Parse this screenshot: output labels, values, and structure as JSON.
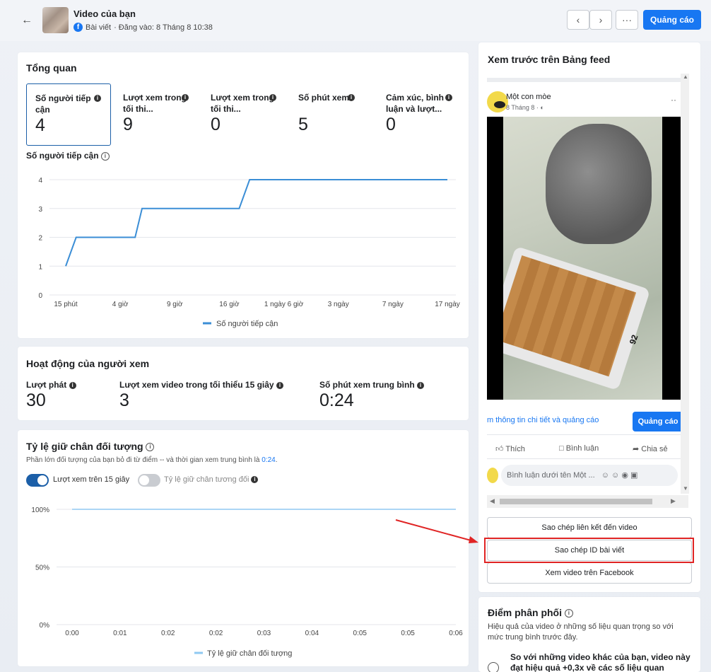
{
  "header": {
    "title": "Video của bạn",
    "subtitle_type": "Bài viết",
    "subtitle_date": "· Đăng vào: 8 Tháng 8 10:38",
    "prev_icon": "chevron-left-icon",
    "next_icon": "chevron-right-icon",
    "more_label": "···",
    "ads_label": "Quảng cáo"
  },
  "overview": {
    "title": "Tổng quan",
    "metrics": [
      {
        "label": "Số người tiếp cận",
        "value": "4"
      },
      {
        "label": "Lượt xem trong tối thi...",
        "value": "9"
      },
      {
        "label": "Lượt xem trong tối thi...",
        "value": "0"
      },
      {
        "label": "Số phút xem",
        "value": "5"
      },
      {
        "label": "Cảm xúc, bình luận và lượt...",
        "value": "0"
      }
    ],
    "chart_label": "Số người tiếp cận"
  },
  "chart_data": [
    {
      "type": "line",
      "title": "Số người tiếp cận",
      "x": [
        "15 phút",
        "4 giờ",
        "9 giờ",
        "16 giờ",
        "1 ngày 6 giờ",
        "3 ngày",
        "7 ngày",
        "17 ngày"
      ],
      "yticks": [
        0,
        1,
        2,
        3,
        4
      ],
      "ylim": [
        0,
        4
      ],
      "series": [
        {
          "name": "Số người tiếp cận",
          "color": "#3b8ed6",
          "points": [
            [
              0,
              1
            ],
            [
              0.06,
              2
            ],
            [
              0.4,
              2
            ],
            [
              0.44,
              3
            ],
            [
              1.0,
              3
            ],
            [
              1.06,
              4
            ],
            [
              1.5,
              4
            ],
            [
              2.2,
              4
            ]
          ]
        }
      ],
      "legend": "bottom-center"
    },
    {
      "type": "line",
      "title": "Tỷ lệ giữ chân đối tượng",
      "x": [
        "0:00",
        "0:01",
        "0:02",
        "0:02",
        "0:03",
        "0:04",
        "0:05",
        "0:05",
        "0:06"
      ],
      "yticks": [
        "0%",
        "50%",
        "100%"
      ],
      "ylim": [
        0,
        100
      ],
      "series": [
        {
          "name": "Tỷ lệ giữ chân đối tượng",
          "color": "#8fc9f2",
          "values": [
            100,
            100,
            100,
            100,
            100,
            100,
            100,
            100,
            100
          ]
        }
      ],
      "legend": "bottom-center"
    }
  ],
  "viewer_activity": {
    "title": "Hoạt động của người xem",
    "stats": [
      {
        "label": "Lượt phát",
        "value": "30"
      },
      {
        "label": "Lượt xem video trong tối thiểu 15 giây",
        "value": "3"
      },
      {
        "label": "Số phút xem trung bình",
        "value": "0:24"
      }
    ]
  },
  "retention": {
    "title": "Tỷ lệ giữ chân đối tượng",
    "desc_prefix": "Phần lớn đối tượng của bạn bỏ đi từ điểm -- và thời gian xem trung bình là ",
    "desc_time": "0:24",
    "desc_suffix": ".",
    "toggle1": "Lượt xem trên 15 giây",
    "toggle2": "Tỷ lệ giữ chân tương đối"
  },
  "preview": {
    "title": "Xem trước trên Bảng feed",
    "page_name": "Một con mòe",
    "post_date": "8 Tháng 8 ·",
    "more": "··",
    "info_link": "m thông tin chi tiết và quảng cáo",
    "ads_button": "Quảng cáo",
    "like": "Thích",
    "comment": "Bình luận",
    "share": "Chia sẻ",
    "comment_placeholder": "Bình luận dưới tên Một ...",
    "video_number": "92"
  },
  "actions": {
    "copy_link": "Sao chép liên kết đến video",
    "copy_id": "Sao chép ID bài viết",
    "watch_fb": "Xem video trên Facebook"
  },
  "distribution": {
    "title": "Điểm phân phối",
    "desc": "Hiệu quả của video ở những số liệu quan trọng so với mức trung bình trước đây.",
    "highlight": "So với những video khác của bạn, video này đạt hiệu quả +0,3x về các số liệu quan"
  },
  "colors": {
    "accent": "#1877f2",
    "line": "#3b8ed6",
    "retention": "#8fc9f2",
    "highlight": "#e02424"
  }
}
